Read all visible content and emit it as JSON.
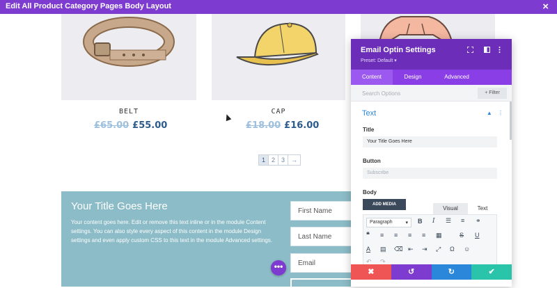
{
  "window": {
    "title": "Edit All Product Category Pages Body Layout",
    "close_icon": "×"
  },
  "products": [
    {
      "name": "BELT",
      "old_price": "£65.00",
      "price": "£55.00"
    },
    {
      "name": "CAP",
      "old_price": "£18.00",
      "price": "£16.00"
    }
  ],
  "pagination": {
    "pages": [
      "1",
      "2",
      "3"
    ],
    "next": "→"
  },
  "optin": {
    "title": "Your Title Goes Here",
    "body": "Your content goes here. Edit or remove this text inline or in the module Content settings. You can also style every aspect of this content in the module Design settings and even apply custom CSS to this text in the module Advanced settings.",
    "fields": [
      "First Name",
      "Last Name",
      "Email"
    ],
    "more_icon": "•••"
  },
  "panel": {
    "title": "Email Optin Settings",
    "preset": "Preset: Default ▾",
    "tabs": [
      "Content",
      "Design",
      "Advanced"
    ],
    "search_placeholder": "Search Options",
    "filter_label": "+ Filter",
    "section_title": "Text",
    "title_label": "Title",
    "title_value": "Your Title Goes Here",
    "button_label": "Button",
    "button_placeholder": "Subscribe",
    "body_label": "Body",
    "add_media": "ADD MEDIA",
    "visual_tab": "Visual",
    "text_tab": "Text",
    "format_select": "Paragraph"
  },
  "colors": {
    "purple": "#7e3bd0",
    "panel_header": "#6c2eb9",
    "accent_blue": "#2b87da",
    "optin_bg": "#8cbcc7",
    "cancel": "#ef5555",
    "save": "#29c4a9"
  }
}
